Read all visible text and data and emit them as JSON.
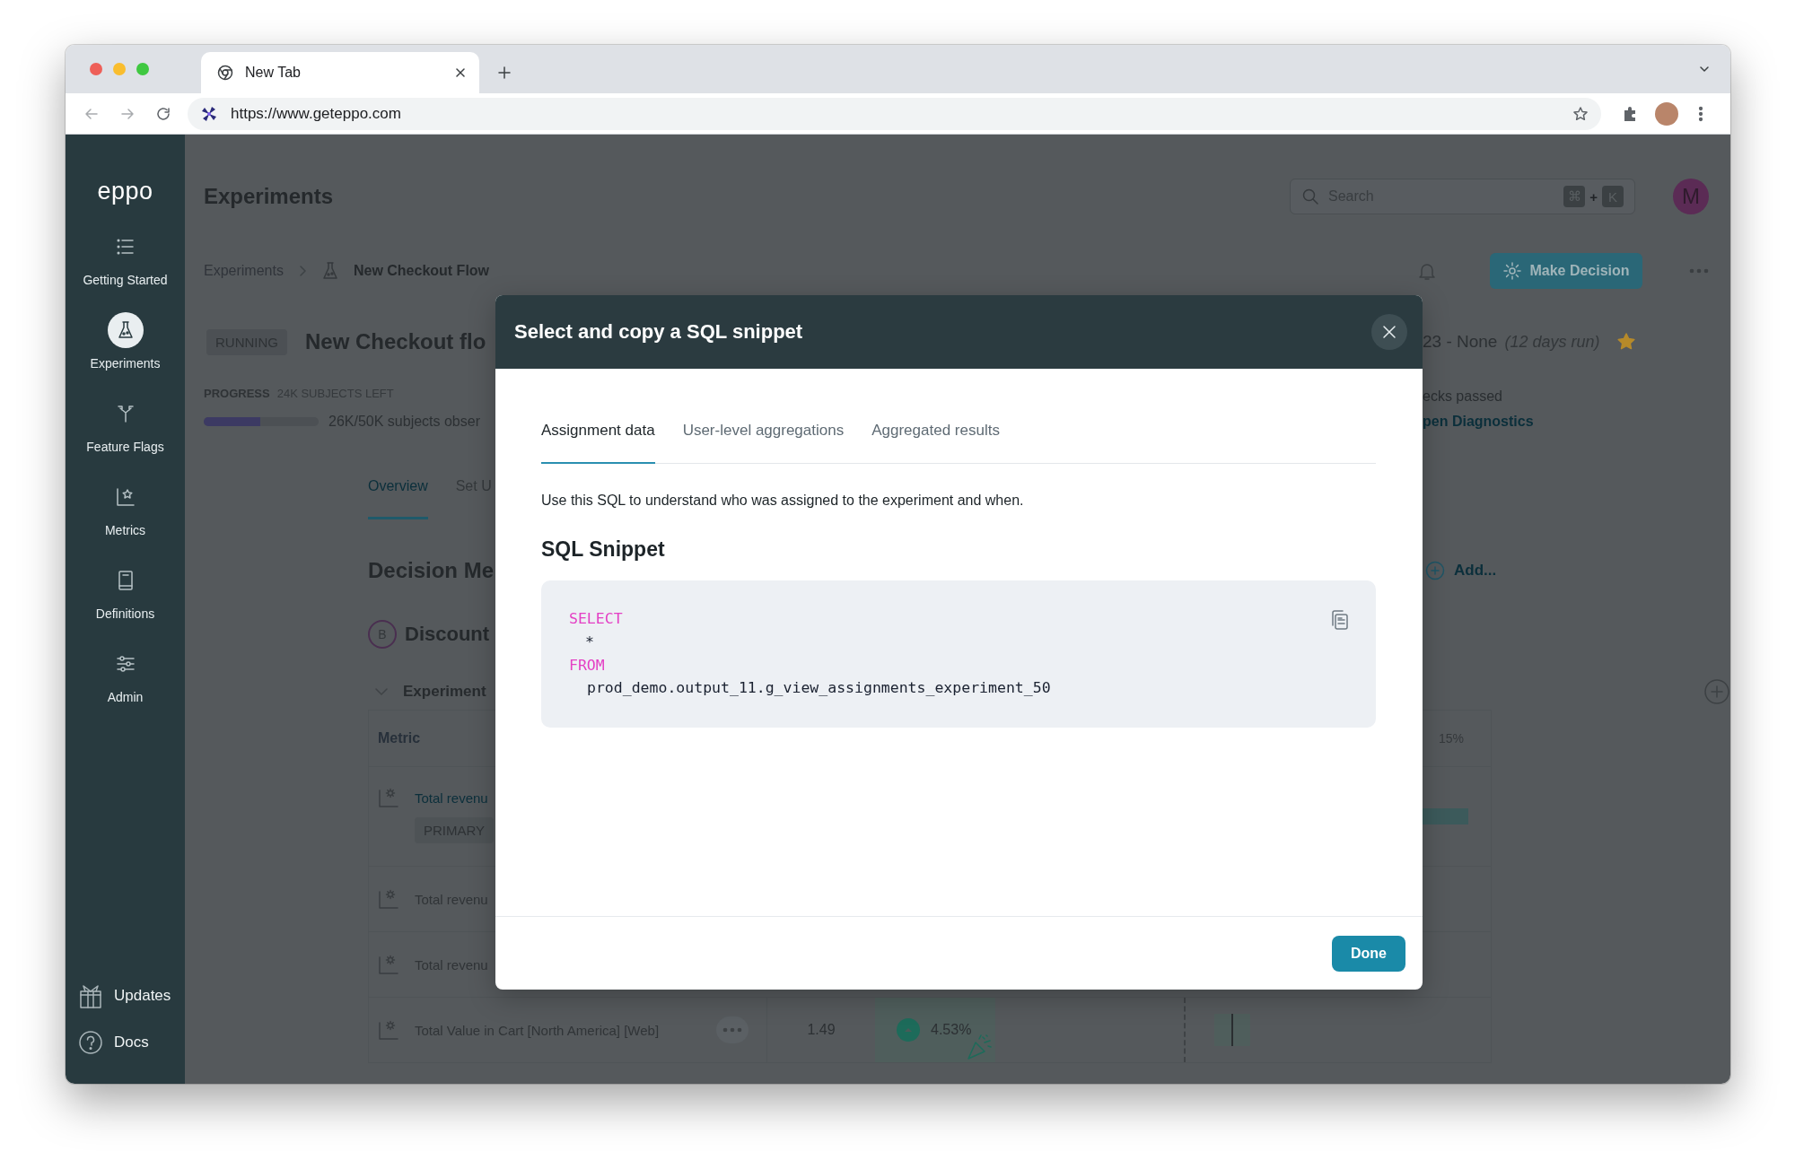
{
  "browser": {
    "tab_title": "New Tab",
    "url": "https://www.geteppo.com"
  },
  "sidebar": {
    "logo": "eppo",
    "items": [
      {
        "label": "Getting Started",
        "selected": false
      },
      {
        "label": "Experiments",
        "selected": true
      },
      {
        "label": "Feature Flags",
        "selected": false
      },
      {
        "label": "Metrics",
        "selected": false
      },
      {
        "label": "Definitions",
        "selected": false
      },
      {
        "label": "Admin",
        "selected": false
      }
    ],
    "footer_items": [
      {
        "label": "Updates"
      },
      {
        "label": "Docs"
      }
    ]
  },
  "header": {
    "title": "Experiments",
    "search": {
      "placeholder": "Search",
      "shortcut_keys": [
        "⌘",
        "K"
      ],
      "joiner": "+"
    },
    "avatar": "M"
  },
  "breadcrumb": {
    "parent": "Experiments",
    "current": "New Checkout Flow"
  },
  "make_decision": "Make Decision",
  "experiment": {
    "status": "RUNNING",
    "title": "New Checkout flo",
    "dates": "23 - None",
    "duration": "(12 days run)",
    "starred": true,
    "progress_label": "PROGRESS",
    "subjects_left": "24K SUBJECTS LEFT",
    "progress": {
      "level": 0.49
    },
    "subjects_observed": "26K/50K subjects obser",
    "checks": "ecks passed",
    "diagnostics_link": "pen Diagnostics"
  },
  "page_tabs": [
    {
      "label": "Overview",
      "selected": true
    },
    {
      "label": "Set U",
      "selected": false
    }
  ],
  "decision": {
    "heading": "Decision Me",
    "add": "Add...",
    "variant": {
      "badge": "B",
      "name": "Discount"
    },
    "section": {
      "title": "Experiment",
      "expanded": true
    }
  },
  "table": {
    "columns": [
      "Metric"
    ],
    "scale_label": "15%",
    "rows": [
      {
        "kind": "covered",
        "metric": "Total revenu",
        "link": true,
        "badge": "PRIMARY",
        "ci_bar": true
      },
      {
        "kind": "covered",
        "metric": "Total revenu",
        "link": false,
        "ci_bar": false
      },
      {
        "kind": "covered",
        "metric": "Total revenu",
        "link": false,
        "ci_bar": false
      },
      {
        "kind": "full",
        "metric": "Total Value in Cart [North America] [Web]",
        "link": false,
        "value": "1.49",
        "lift": "4.53%",
        "ci_bar": true
      }
    ]
  },
  "modal": {
    "title": "Select and copy a SQL snippet",
    "tabs": [
      {
        "label": "Assignment data",
        "selected": true
      },
      {
        "label": "User-level aggregations",
        "selected": false
      },
      {
        "label": "Aggregated results",
        "selected": false
      }
    ],
    "description": "Use this SQL to understand who was assigned to the experiment and when.",
    "heading": "SQL Snippet",
    "code_lines": [
      {
        "kind": "keyword",
        "text": "SELECT"
      },
      {
        "kind": "body",
        "text": "*"
      },
      {
        "kind": "keyword",
        "text": "FROM"
      },
      {
        "kind": "body",
        "text": "prod_demo.output_11.g_view_assignments_experiment_50"
      }
    ],
    "done": "Done"
  }
}
